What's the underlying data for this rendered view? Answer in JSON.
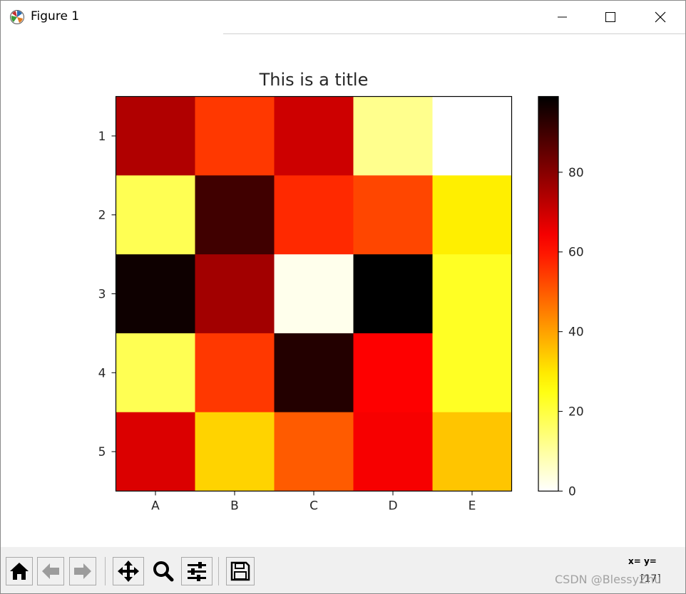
{
  "window": {
    "title": "Figure 1"
  },
  "toolbar": {
    "coords_label": "x= y=",
    "coords_value": "[17]"
  },
  "watermark": "CSDN @BlessyZhu",
  "chart_data": {
    "type": "heatmap",
    "title": "This is a title",
    "x_labels": [
      "A",
      "B",
      "C",
      "D",
      "E"
    ],
    "y_labels": [
      "1",
      "2",
      "3",
      "4",
      "5"
    ],
    "values": [
      [
        74,
        55,
        70,
        12,
        0
      ],
      [
        18,
        90,
        57,
        53,
        29
      ],
      [
        97,
        76,
        2,
        99,
        23
      ],
      [
        18,
        55,
        94,
        63,
        23
      ],
      [
        68,
        33,
        50,
        64,
        35
      ]
    ],
    "colormap": "hot_r",
    "colorbar": {
      "min": 0,
      "max": 99,
      "ticks": [
        0,
        20,
        40,
        60,
        80
      ]
    }
  }
}
